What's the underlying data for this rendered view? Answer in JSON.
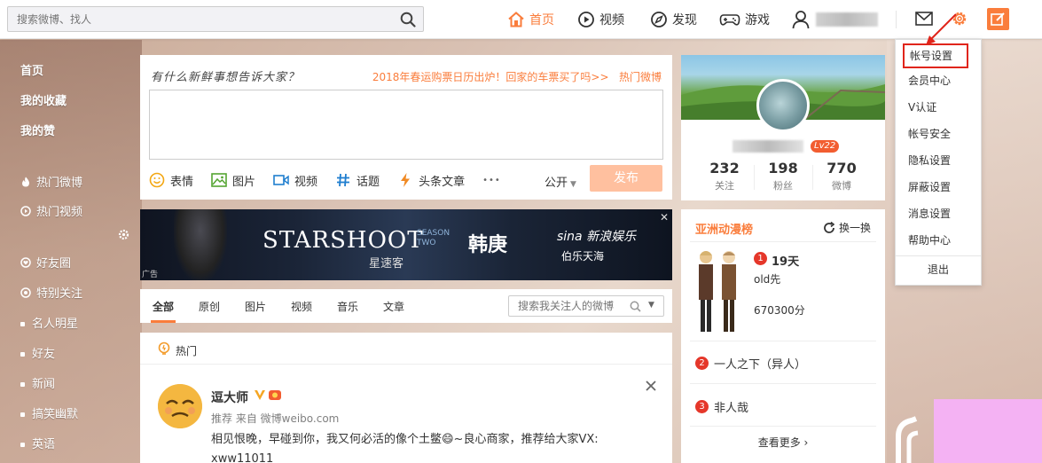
{
  "header": {
    "search_placeholder": "搜索微博、找人",
    "nav": [
      {
        "label": "首页",
        "icon": "home-icon",
        "active": true
      },
      {
        "label": "视频",
        "icon": "video-play-icon"
      },
      {
        "label": "发现",
        "icon": "compass-icon"
      },
      {
        "label": "游戏",
        "icon": "gamepad-icon"
      }
    ]
  },
  "sidebar": {
    "items": [
      {
        "label": "首页",
        "bold": true
      },
      {
        "label": "我的收藏",
        "bold": true
      },
      {
        "label": "我的赞",
        "bold": true
      },
      {
        "label": "热门微博",
        "icon": "fire-icon"
      },
      {
        "label": "热门视频",
        "icon": "video-icon"
      },
      {
        "label": "好友圈",
        "icon": "heart-icon"
      },
      {
        "label": "特别关注",
        "icon": "star-icon"
      },
      {
        "label": "名人明星"
      },
      {
        "label": "好友"
      },
      {
        "label": "新闻"
      },
      {
        "label": "搞笑幽默"
      },
      {
        "label": "英语"
      }
    ]
  },
  "publish": {
    "prompt": "有什么新鲜事想告诉大家？",
    "promo": "2018年春运购票日历出炉！回家的车票买了吗>>",
    "hot_link": "热门微博",
    "tools": [
      {
        "label": "表情",
        "icon": "emoji-icon"
      },
      {
        "label": "图片",
        "icon": "image-icon"
      },
      {
        "label": "视频",
        "icon": "video-icon"
      },
      {
        "label": "话题",
        "icon": "hashtag-icon"
      },
      {
        "label": "头条文章",
        "icon": "lightning-icon"
      }
    ],
    "more": "•••",
    "visibility": "公开",
    "send_label": "发布"
  },
  "banner": {
    "title_en": "STARSHOOT",
    "title_cn": "星速客",
    "season": "SEASON TWO",
    "star": "韩庚",
    "brand": "sina 新浪娱乐",
    "partner": "伯乐天海",
    "ad_label": "广告",
    "close": "✕"
  },
  "tabs": {
    "items": [
      "全部",
      "原创",
      "图片",
      "视频",
      "音乐",
      "文章"
    ],
    "search_placeholder": "搜索我关注人的微博"
  },
  "feed": {
    "section_label": "热门",
    "username": "逗大师",
    "meta": "推荐 来自 微博weibo.com",
    "text": "相见恨晚，早碰到你，我又何必活的像个土鳖😄~良心商家，推荐给大家VX: xww11011"
  },
  "profile": {
    "level": "Lv22",
    "stats": [
      {
        "num": "232",
        "label": "关注"
      },
      {
        "num": "198",
        "label": "粉丝"
      },
      {
        "num": "770",
        "label": "微博"
      }
    ]
  },
  "ranking": {
    "title": "亚洲动漫榜",
    "refresh": "换一换",
    "first": {
      "rank": "1",
      "days": "19天",
      "name": "old先",
      "score": "670300分"
    },
    "items": [
      {
        "rank": "2",
        "title": "一人之下（异人）"
      },
      {
        "rank": "3",
        "title": "非人哉"
      }
    ],
    "more": "查看更多 ›"
  },
  "settings_menu": {
    "items": [
      "帐号设置",
      "会员中心",
      "V认证",
      "帐号安全",
      "隐私设置",
      "屏蔽设置",
      "消息设置",
      "帮助中心"
    ],
    "logout": "退出",
    "highlight_color": "#e0251b"
  },
  "colors": {
    "accent": "#fa7d3c",
    "send_disabled": "#ffc09f",
    "level_badge": "#f25d30",
    "rank_red": "#e5372a",
    "pink_block": "#f4b2f3"
  }
}
